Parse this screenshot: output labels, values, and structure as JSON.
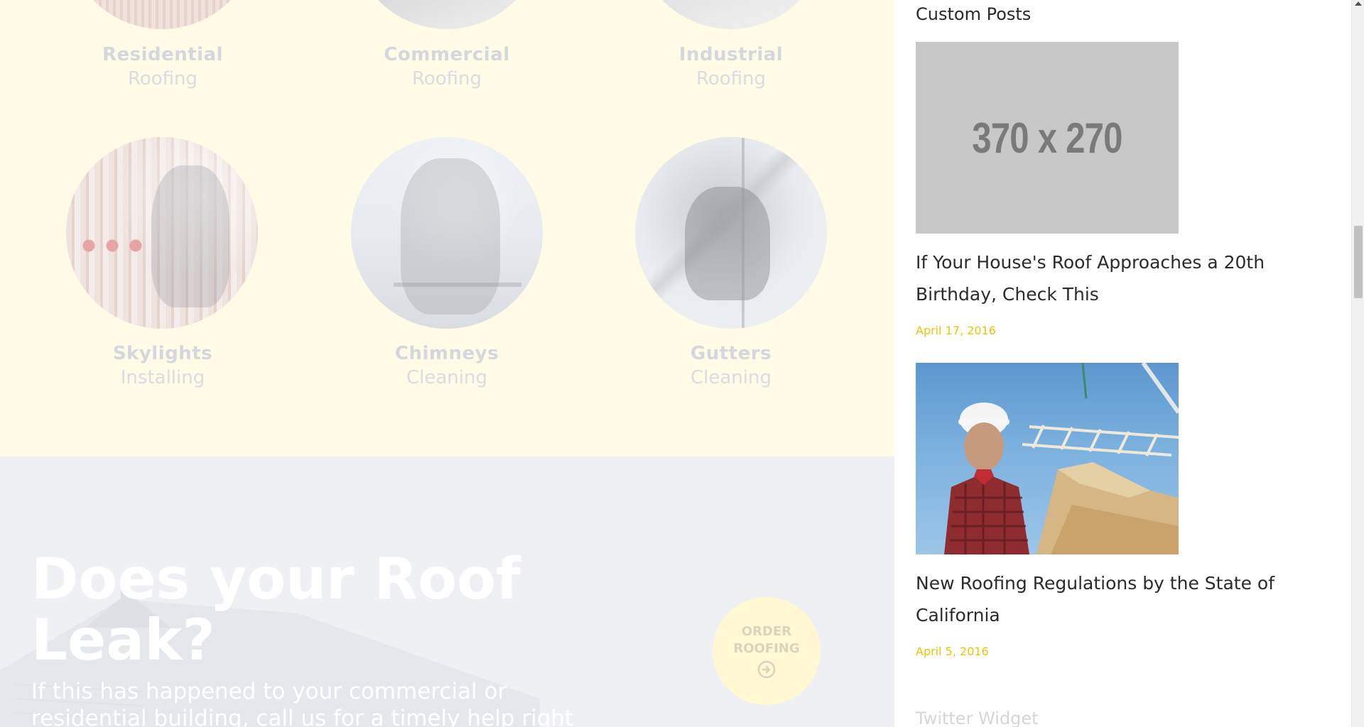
{
  "services": {
    "row1": [
      {
        "title": "Residential",
        "subtitle": "Roofing"
      },
      {
        "title": "Commercial",
        "subtitle": "Roofing"
      },
      {
        "title": "Industrial",
        "subtitle": "Roofing"
      }
    ],
    "row2": [
      {
        "title": "Skylights",
        "subtitle": "Installing"
      },
      {
        "title": "Chimneys",
        "subtitle": "Cleaning"
      },
      {
        "title": "Gutters",
        "subtitle": "Cleaning"
      }
    ]
  },
  "banner": {
    "heading": "Does your Roof Leak?",
    "text": "If this has happened to your commercial or residential building, call us for a timely help right away!",
    "order_button": "ORDER ROOFING",
    "order_icon": "arrow-circle-right-icon"
  },
  "sidebar": {
    "custom_posts_title": "Custom Posts",
    "posts": [
      {
        "thumb_text": "370 x 270",
        "title": "If Your House's Roof Approaches a 20th Birthday, Check This",
        "date": "April 17, 2016"
      },
      {
        "title": "New Roofing Regulations by the State of California",
        "date": "April 5, 2016"
      }
    ],
    "twitter_title": "Twitter Widget"
  },
  "colors": {
    "accent": "#f2c200",
    "services_bg": "#fffbe6",
    "banner_bg": "#eef0f3",
    "order_button_bg": "#fff8d2"
  }
}
